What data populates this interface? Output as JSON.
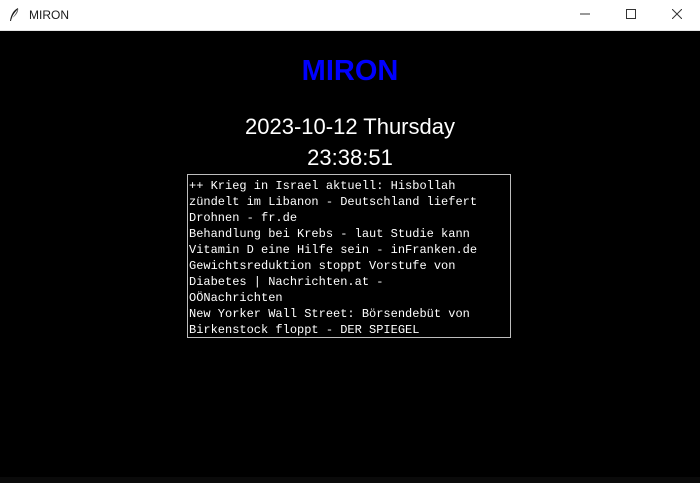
{
  "window": {
    "title": "MIRON",
    "icons": {
      "app": "feather-icon",
      "minimize": "minimize-icon",
      "maximize": "maximize-icon",
      "close": "close-icon"
    }
  },
  "main": {
    "heading": "MIRON",
    "date": "2023-10-12 Thursday",
    "time": "23:38:51",
    "news_lines": [
      "++ Krieg in Israel aktuell: Hisbollah",
      "zündelt im Libanon - Deutschland liefert",
      "Drohnen - fr.de",
      "Behandlung bei Krebs - laut Studie kann",
      "Vitamin D eine Hilfe sein - inFranken.de",
      "Gewichtsreduktion stoppt Vorstufe von",
      "Diabetes | Nachrichten.at -",
      "OÖNachrichten",
      "New Yorker Wall Street: Börsendebüt von",
      "Birkenstock floppt - DER SPIEGEL"
    ]
  },
  "colors": {
    "background": "#000000",
    "heading": "#0000ff",
    "text": "#ffffff",
    "titlebar": "#ffffff"
  }
}
